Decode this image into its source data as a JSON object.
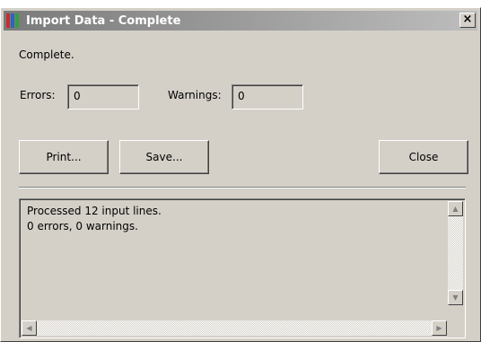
{
  "window": {
    "title": "Import Data - Complete",
    "close_symbol": "×",
    "icon": "import-data-app-icon"
  },
  "status": "Complete.",
  "errors": {
    "label": "Errors:",
    "value": "0"
  },
  "warnings": {
    "label": "Warnings:",
    "value": "0"
  },
  "buttons": {
    "print": "Print...",
    "save": "Save...",
    "close": "Close"
  },
  "log": {
    "lines": [
      "Processed 12 input lines.",
      "0 errors, 0 warnings."
    ]
  },
  "scrollbar": {
    "up": "▲",
    "down": "▼",
    "left": "◀",
    "right": "▶"
  },
  "colors": {
    "face": "#d4d0c8",
    "title_gradient_start": "#7a7a7a",
    "title_gradient_end": "#bdbdbd"
  }
}
